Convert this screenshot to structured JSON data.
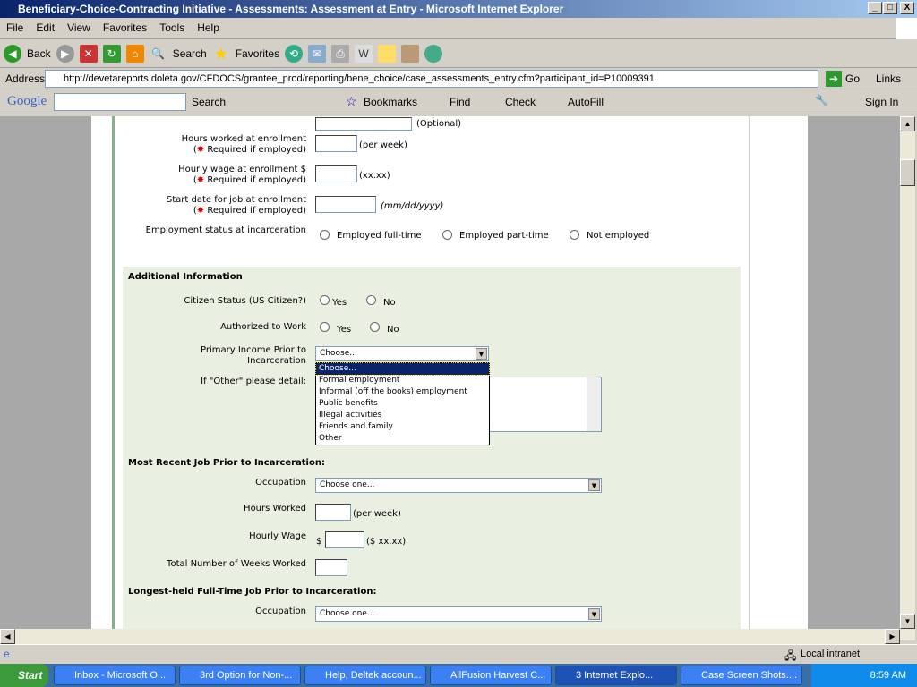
{
  "window": {
    "title": "Beneficiary-Choice-Contracting Initiative - Assessments: Assessment at Entry - Microsoft Internet Explorer"
  },
  "menu": [
    "File",
    "Edit",
    "View",
    "Favorites",
    "Tools",
    "Help"
  ],
  "toolbar": {
    "back": "Back",
    "search": "Search",
    "favorites": "Favorites"
  },
  "address": {
    "label": "Address",
    "url": "http://devetareports.doleta.gov/CFDOCS/grantee_prod/reporting/bene_choice/case_assessments_entry.cfm?participant_id=P10009391",
    "go": "Go",
    "links": "Links"
  },
  "google": {
    "logo": "Google",
    "search": "Search",
    "bookmarks": "Bookmarks",
    "find": "Find",
    "check": "Check",
    "autofill": "AutoFill",
    "signin": "Sign In"
  },
  "form": {
    "optional": "(Optional)",
    "hours_label": "Hours worked at enrollment",
    "required": "Required if employed",
    "per_week": "(per week)",
    "wage_label": "Hourly wage at enrollment $",
    "wage_fmt": "(xx.xx)",
    "start_label": "Start date for job at enrollment",
    "date_fmt": "(mm/dd/yyyy)",
    "emp_status_label": "Employment status at incarceration",
    "emp_options": [
      "Employed full-time",
      "Employed part-time",
      "Not employed"
    ],
    "additional_heading": "Additional Information",
    "citizen_label": "Citizen Status (US Citizen?)",
    "yes": "Yes",
    "no": "No",
    "auth_label": "Authorized to Work",
    "income_label_1": "Primary Income Prior to",
    "income_label_2": "Incarceration",
    "income_selected": "Choose...",
    "income_options": [
      "Choose...",
      "Formal employment",
      "Informal (off the books) employment",
      "Public benefits",
      "Illegal activities",
      "Friends and family",
      "Other"
    ],
    "other_label": "If \"Other\" please detail:",
    "recent_heading": "Most Recent Job Prior to Incarceration:",
    "occupation_label": "Occupation",
    "occupation_value": "Choose one...",
    "hours_worked_label": "Hours Worked",
    "hourly_wage_label": "Hourly Wage",
    "dollar": "$",
    "wage_fmt2": "($ xx.xx)",
    "weeks_label": "Total Number of Weeks Worked",
    "longest_heading": "Longest-held Full-Time Job Prior to Incarceration:"
  },
  "status": {
    "zone": "Local intranet"
  },
  "taskbar": {
    "start": "Start",
    "tasks": [
      "Inbox - Microsoft O...",
      "3rd Option for Non-...",
      "Help, Deltek accoun...",
      "AllFusion Harvest C...",
      "3 Internet Explo...",
      "Case Screen Shots...."
    ],
    "time": "8:59 AM"
  }
}
